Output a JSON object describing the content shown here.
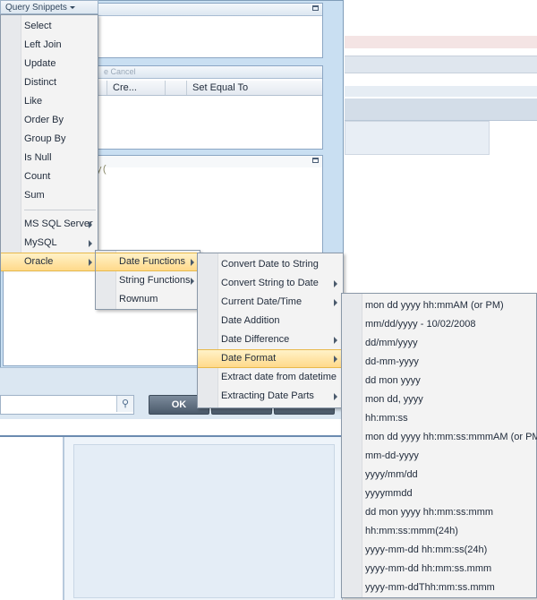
{
  "snippets": {
    "title": "Query Snippets",
    "items": [
      "Select",
      "Left Join",
      "Update",
      "Distinct",
      "Like",
      "Order By",
      "Group By",
      "Is Null",
      "Count",
      "Sum"
    ],
    "db_items": [
      "MS SQL Server",
      "MySQL",
      "Oracle"
    ]
  },
  "oracle_menu": [
    "Date Functions",
    "String Functions",
    "Rownum"
  ],
  "date_functions_menu": [
    "Convert Date to String",
    "Convert String to Date",
    "Current Date/Time",
    "Date Addition",
    "Date Difference",
    "Date Format",
    "Extract date from datetime",
    "Extracting Date Parts"
  ],
  "date_format_menu": [
    "mon dd yyyy hh:mmAM (or PM)",
    "mm/dd/yyyy - 10/02/2008",
    "dd/mm/yyyy",
    "dd-mm-yyyy",
    "dd mon yyyy",
    "mon dd, yyyy",
    "hh:mm:ss",
    "mon dd yyyy hh:mm:ss:mmmAM (or PM)",
    "mm-dd-yyyy",
    "yyyy/mm/dd",
    "yyyymmdd",
    "dd mon yyyy hh:mm:ss:mmm",
    "hh:mm:ss:mmm(24h)",
    "yyyy-mm-dd hh:mm:ss(24h)",
    "yyyy-mm-dd hh:mm:ss.mmm",
    "yyyy-mm-ddThh:mm:ss.mmm"
  ],
  "grid": {
    "toolbar_fragment": "e  Cancel",
    "columns": [
      "Cre...",
      "Set Equal To"
    ]
  },
  "code_fragment": "ery(",
  "buttons": {
    "ok": "OK"
  }
}
